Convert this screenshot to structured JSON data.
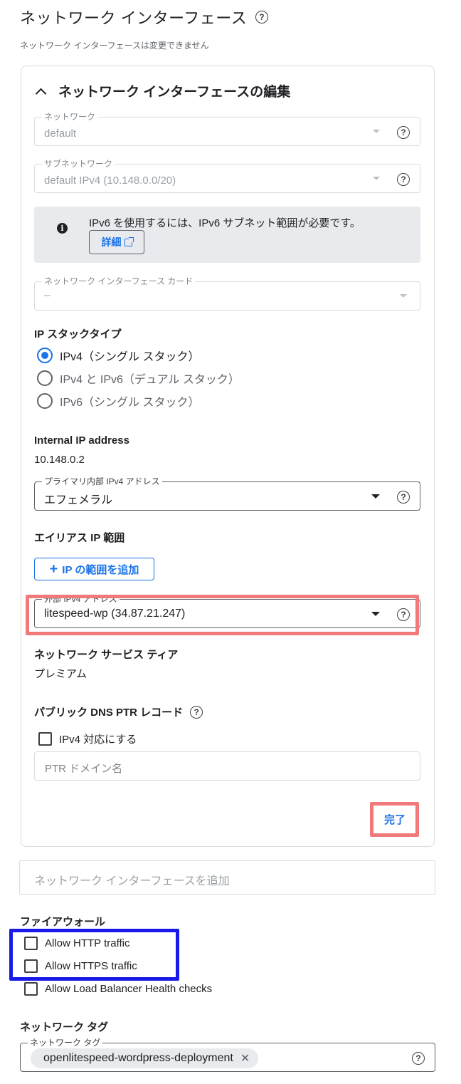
{
  "header": {
    "title": "ネットワーク インターフェース",
    "subtitle": "ネットワーク インターフェースは変更できません"
  },
  "icons": {
    "help": "help-circle-icon",
    "info": "info-icon",
    "external": "external-link-icon",
    "caret": "caret-down-icon",
    "chevron": "chevron-up-icon",
    "add": "plus-icon",
    "close": "close-icon"
  },
  "editor": {
    "title": "ネットワーク インターフェースの編集",
    "network": {
      "label": "ネットワーク",
      "value": "default"
    },
    "subnetwork": {
      "label": "サブネットワーク",
      "value": "default IPv4 (10.148.0.0/20)"
    },
    "info": {
      "text": "IPv6 を使用するには、IPv6 サブネット範囲が必要です。",
      "link_label": "詳細"
    },
    "nic_card": {
      "label": "ネットワーク インターフェース カード",
      "value": "–"
    },
    "ip_stack": {
      "title": "IP スタックタイプ",
      "options": [
        {
          "label": "IPv4（シングル スタック）",
          "selected": true
        },
        {
          "label": "IPv4 と IPv6（デュアル スタック）",
          "selected": false
        },
        {
          "label": "IPv6（シングル スタック）",
          "selected": false
        }
      ]
    },
    "internal_ip": {
      "title": "Internal IP address",
      "value": "10.148.0.2"
    },
    "primary_ipv4": {
      "label": "プライマリ内部 IPv4 アドレス",
      "value": "エフェメラル"
    },
    "alias": {
      "title": "エイリアス IP 範囲",
      "add_label": "IP の範囲を追加"
    },
    "external_ipv4": {
      "label": "外部 IPv4 アドレス",
      "value": "litespeed-wp (34.87.21.247)"
    },
    "tier": {
      "title": "ネットワーク サービス ティア",
      "value": "プレミアム"
    },
    "ptr": {
      "title": "パブリック DNS PTR レコード",
      "checkbox_label": "IPv4 対応にする",
      "placeholder": "PTR ドメイン名"
    },
    "done_label": "完了"
  },
  "add_interface_label": "ネットワーク インターフェースを追加",
  "firewall": {
    "title": "ファイアウォール",
    "options": [
      {
        "label": "Allow HTTP traffic",
        "checked": false
      },
      {
        "label": "Allow HTTPS traffic",
        "checked": false
      },
      {
        "label": "Allow Load Balancer Health checks",
        "checked": false
      }
    ]
  },
  "tags": {
    "title": "ネットワーク タグ",
    "field_label": "ネットワーク タグ",
    "chips": [
      "openlitespeed-wordpress-deployment"
    ]
  },
  "colors": {
    "accent": "#1a73e8",
    "highlight_red": "#f07a7a",
    "highlight_blue": "#1a1ae8"
  }
}
